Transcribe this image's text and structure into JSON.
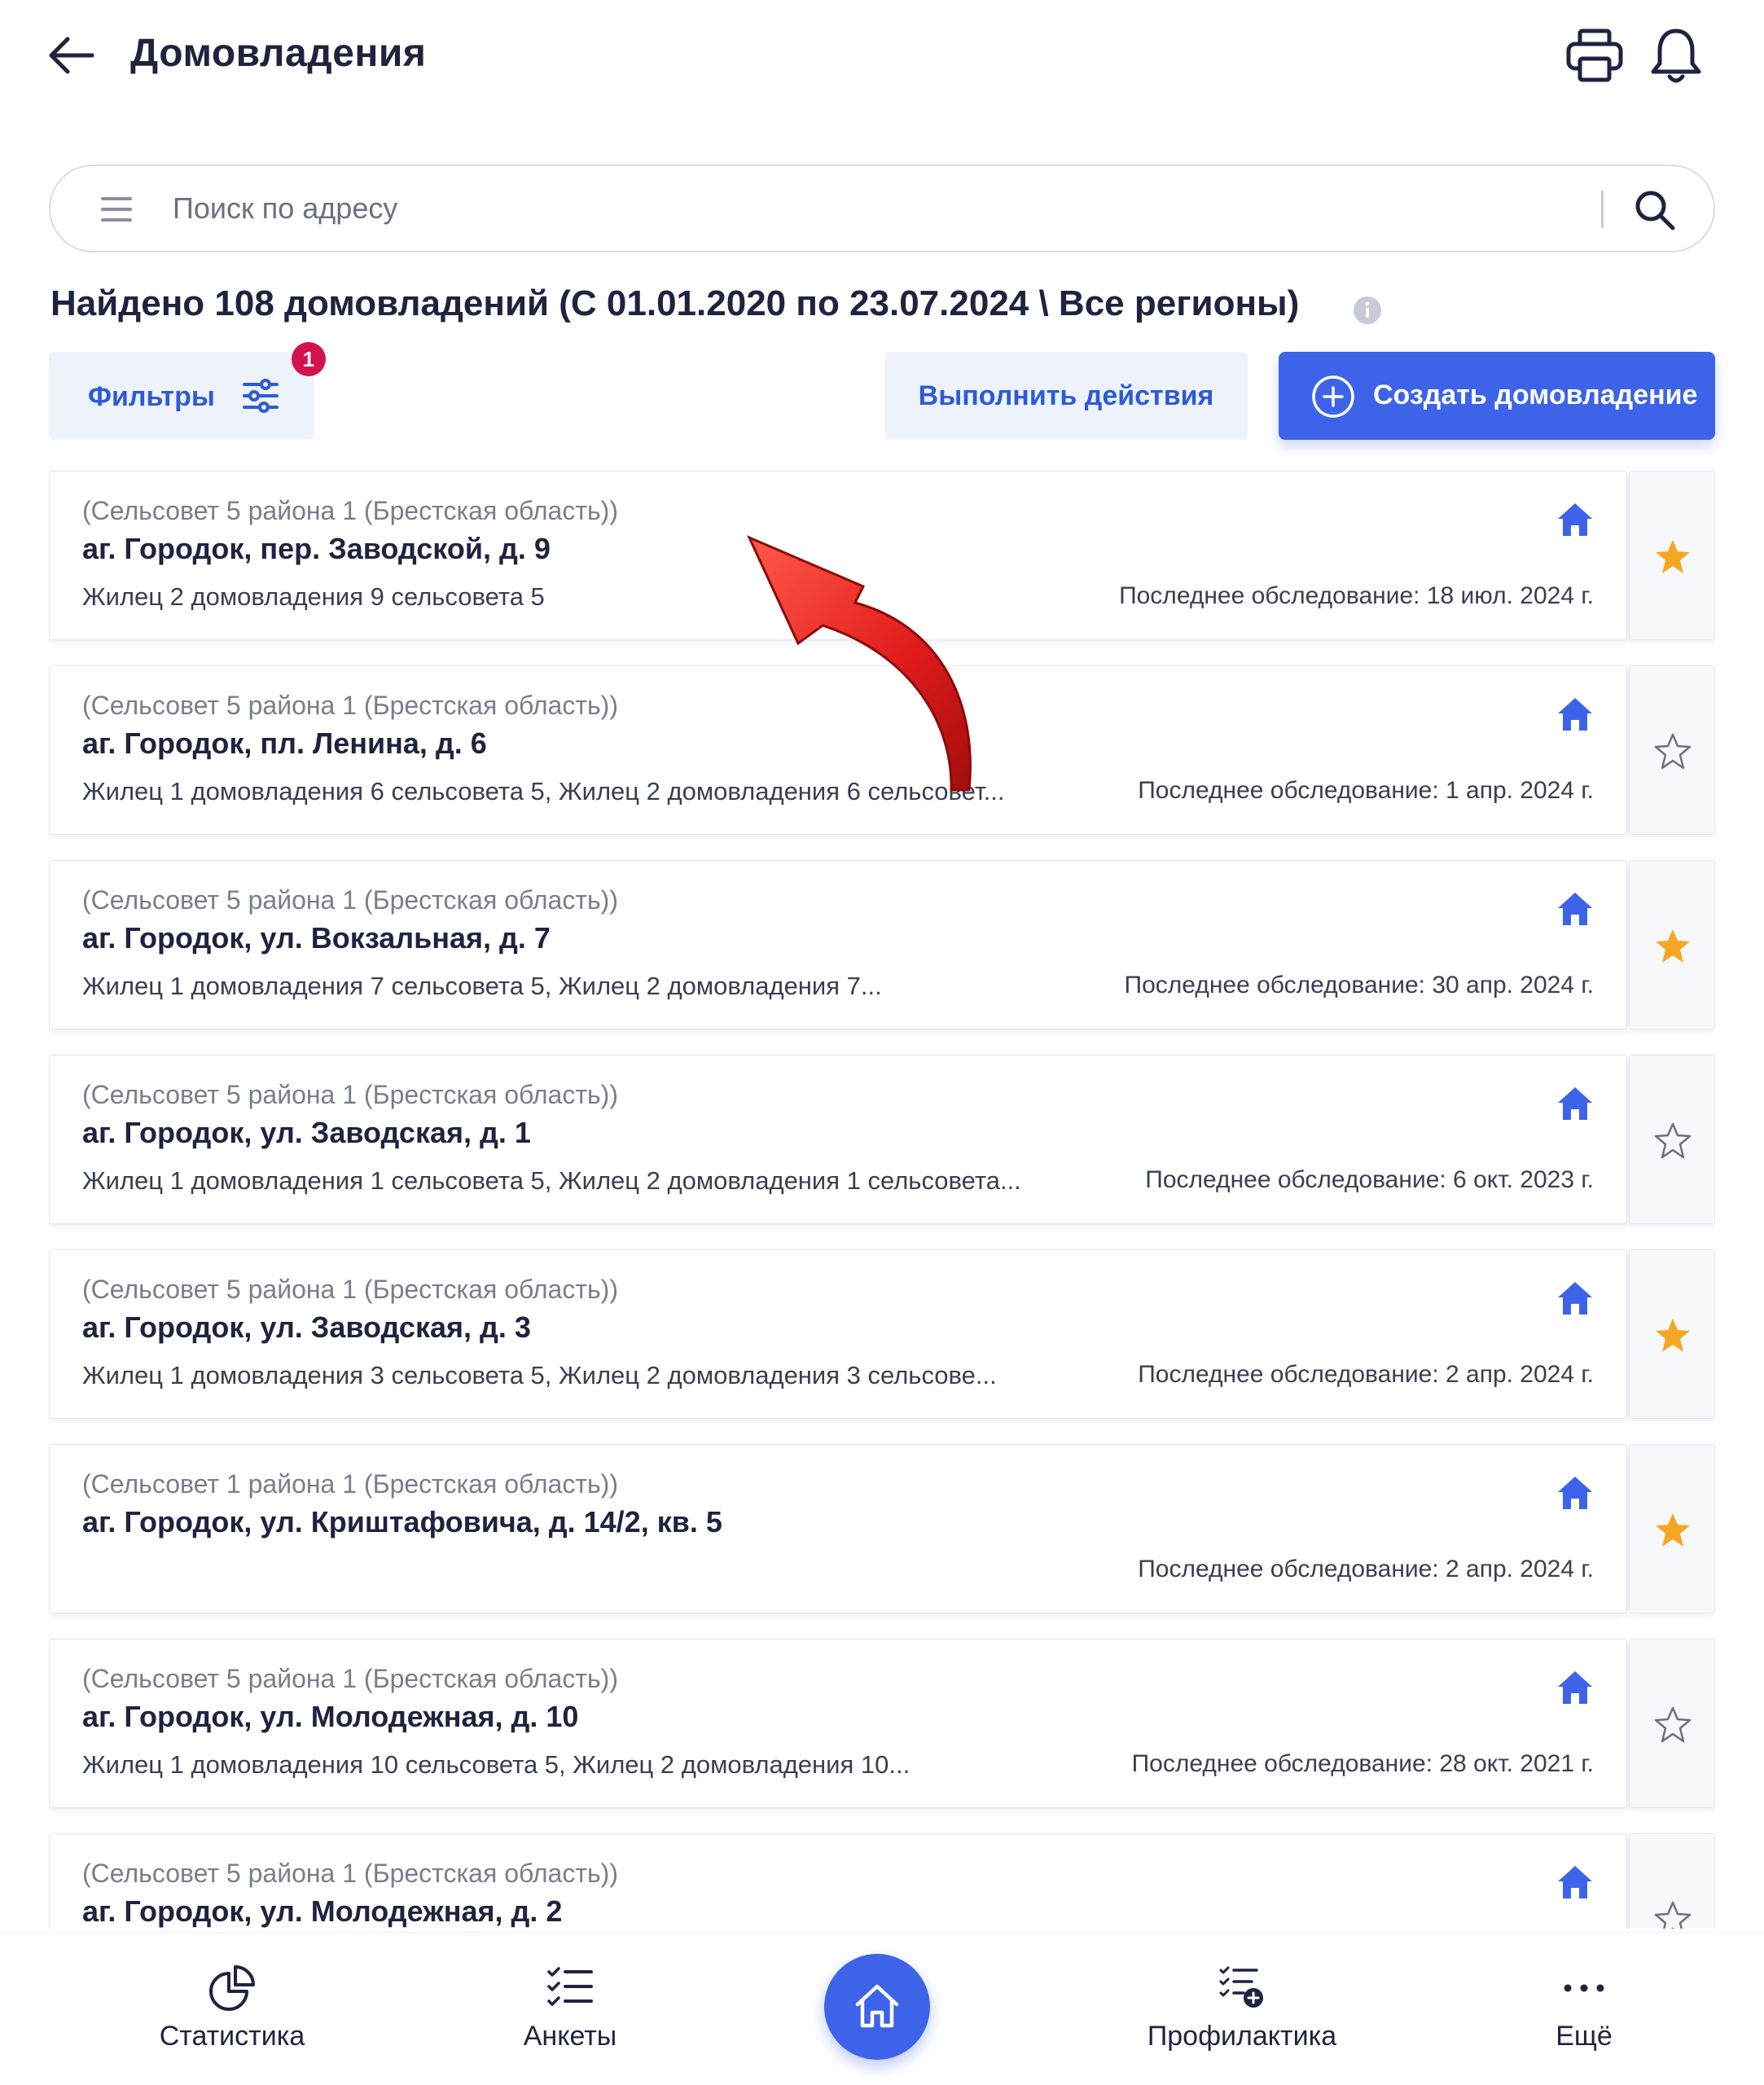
{
  "header": {
    "title": "Домовладения",
    "back_icon": "arrow-left-icon",
    "print_icon": "printer-icon",
    "notifications_icon": "bell-icon"
  },
  "search": {
    "placeholder": "Поиск по адресу",
    "value": ""
  },
  "results": {
    "title": "Найдено 108 домовладений (С 01.01.2020 по 23.07.2024 \\ Все регионы)"
  },
  "toolbar": {
    "filters_label": "Фильтры",
    "filters_badge": "1",
    "actions_label": "Выполнить действия",
    "create_label": "Создать домовладение"
  },
  "colors": {
    "accent": "#3d64e8",
    "badge": "#d3134d",
    "star": "#f5a623",
    "house": "#3d64e8"
  },
  "households": [
    {
      "region": "(Сельсовет 5 района 1 (Брестская область))",
      "address": "аг. Городок, пер. Заводской, д. 9",
      "residents": "Жилец 2 домовладения 9 сельсовета 5",
      "survey": "Последнее обследование: 18 июл. 2024 г.",
      "favorite": true
    },
    {
      "region": "(Сельсовет 5 района 1 (Брестская область))",
      "address": "аг. Городок, пл. Ленина, д. 6",
      "residents": "Жилец 1 домовладения 6 сельсовета 5, Жилец 2 домовладения 6 сельсовет...",
      "survey": "Последнее обследование: 1 апр. 2024 г.",
      "favorite": false
    },
    {
      "region": "(Сельсовет 5 района 1 (Брестская область))",
      "address": "аг. Городок, ул. Вокзальная, д. 7",
      "residents": "Жилец 1 домовладения 7 сельсовета 5, Жилец 2 домовладения 7...",
      "survey": "Последнее обследование: 30 апр. 2024 г.",
      "favorite": true
    },
    {
      "region": "(Сельсовет 5 района 1 (Брестская область))",
      "address": "аг. Городок, ул. Заводская, д. 1",
      "residents": "Жилец 1 домовладения 1 сельсовета 5, Жилец 2 домовладения 1 сельсовета...",
      "survey": "Последнее обследование: 6 окт. 2023 г.",
      "favorite": false
    },
    {
      "region": "(Сельсовет 5 района 1 (Брестская область))",
      "address": "аг. Городок, ул. Заводская, д. 3",
      "residents": "Жилец 1 домовладения 3 сельсовета 5, Жилец 2 домовладения 3 сельсове...",
      "survey": "Последнее обследование: 2 апр. 2024 г.",
      "favorite": true
    },
    {
      "region": "(Сельсовет 1 района 1 (Брестская область))",
      "address": "аг. Городок, ул. Криштафовича, д. 14/2, кв. 5",
      "residents": "",
      "survey": "Последнее обследование: 2 апр. 2024 г.",
      "favorite": true
    },
    {
      "region": "(Сельсовет 5 района 1 (Брестская область))",
      "address": "аг. Городок, ул. Молодежная, д. 10",
      "residents": "Жилец 1 домовладения 10 сельсовета 5, Жилец 2 домовладения 10...",
      "survey": "Последнее обследование: 28 окт. 2021 г.",
      "favorite": false
    },
    {
      "region": "(Сельсовет 5 района 1 (Брестская область))",
      "address": "аг. Городок, ул. Молодежная, д. 2",
      "residents": "",
      "survey": "",
      "favorite": false
    }
  ],
  "bottom_nav": {
    "stats_label": "Статистика",
    "forms_label": "Анкеты",
    "home_icon": "home-icon",
    "prevention_label": "Профилактика",
    "more_label": "Ещё"
  }
}
